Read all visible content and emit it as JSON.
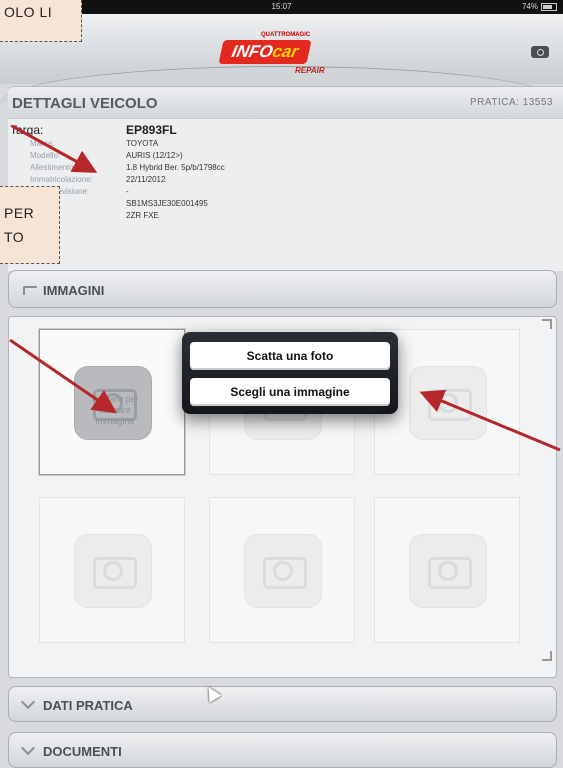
{
  "status_bar": {
    "time": "15:07",
    "battery": "74%"
  },
  "header": {
    "logo_top": "QUATTROMAGIC",
    "logo_main_a": "INFO",
    "logo_main_b": "car",
    "logo_sub": "REPAIR"
  },
  "vehicle": {
    "title": "DETTAGLI VEICOLO",
    "pratica_label": "PRATICA:",
    "pratica_number": "13553",
    "rows": [
      {
        "label": "Targa:",
        "value": "EP893FL"
      },
      {
        "label": "Marca:",
        "value": "TOYOTA"
      },
      {
        "label": "Modello:",
        "value": "AURIS (12/12>)"
      },
      {
        "label": "Allestimento:",
        "value": "1.8 Hybrid Ber. 5p/b/1798cc"
      },
      {
        "label": "Immatricolazione:",
        "value": "22/11/2012"
      },
      {
        "label": "Ultima revisione:",
        "value": "-"
      },
      {
        "label": "Telaio:",
        "value": "SB1MS3JE30E001495"
      },
      {
        "label": "Motore:",
        "value": "2ZR FXE"
      }
    ]
  },
  "images_section": {
    "label": "IMMAGINI",
    "placeholder_text": "Toccare per caricare immagine"
  },
  "popup": {
    "take_photo": "Scatta una foto",
    "choose_image": "Scegli una immagine"
  },
  "bottom": {
    "dati_pratica": "DATI PRATICA",
    "documenti": "DOCUMENTI"
  },
  "callouts": {
    "top": "OLO LI",
    "middle_line1": "PER",
    "middle_line2": "TO"
  },
  "colors": {
    "accent_red": "#e4281e",
    "arrow": "#b5272a",
    "callout_bg": "#f8e4d6"
  }
}
